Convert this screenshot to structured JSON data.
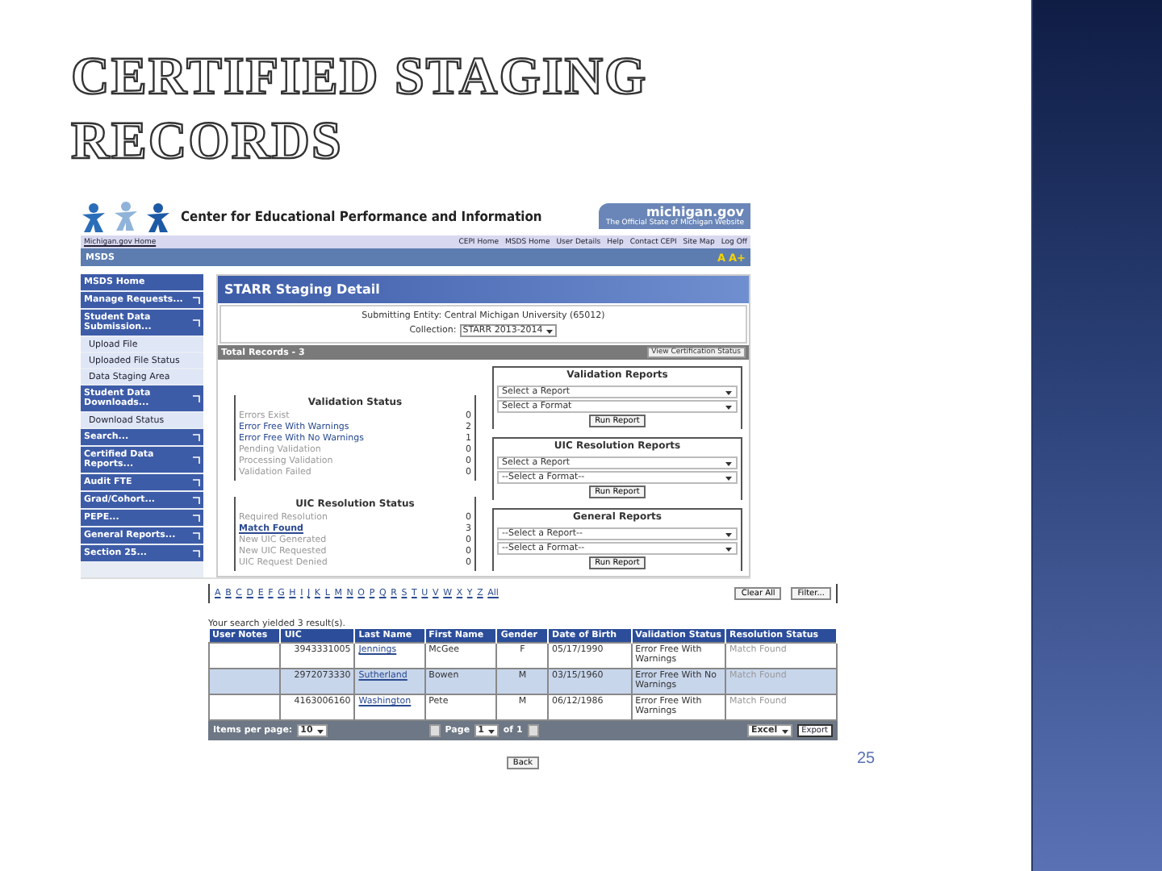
{
  "slide": {
    "title": "CERTIFIED STAGING RECORDS",
    "page_number": "25"
  },
  "header": {
    "agency": "Center for Educational Performance and Information",
    "state_logo": "michigan.gov",
    "state_tagline": "The Official State of Michigan Website"
  },
  "top_links": {
    "home": "Michigan.gov Home",
    "links": [
      "CEPI Home",
      "MSDS Home",
      "User Details",
      "Help",
      "Contact CEPI",
      "Site Map",
      "Log Off"
    ]
  },
  "app_bar": {
    "title": "MSDS",
    "font_buttons": [
      "A",
      "A+"
    ]
  },
  "sidebar": {
    "items": [
      {
        "label": "MSDS Home",
        "has_menu": false
      },
      {
        "label": "Manage Requests...",
        "has_menu": true
      },
      {
        "label": "Student Data Submission...",
        "has_menu": true,
        "children": [
          "Upload File",
          "Uploaded File Status",
          "Data Staging Area"
        ]
      },
      {
        "label": "Student Data Downloads...",
        "has_menu": true,
        "children": [
          "Download Status"
        ]
      },
      {
        "label": "Search...",
        "has_menu": true
      },
      {
        "label": "Certified Data Reports...",
        "has_menu": true
      },
      {
        "label": "Audit FTE",
        "has_menu": true
      },
      {
        "label": "Grad/Cohort...",
        "has_menu": true
      },
      {
        "label": "PEPE...",
        "has_menu": true
      },
      {
        "label": "General Reports...",
        "has_menu": true
      },
      {
        "label": "Section 25...",
        "has_menu": true
      }
    ]
  },
  "main": {
    "title": "STARR Staging Detail",
    "entity": "Submitting Entity: Central Michigan University (65012)",
    "collection_label": "Collection:",
    "collection": "STARR 2013-2014",
    "total": "Total Records - 3",
    "status_button": "View Certification Status",
    "status_panels": [
      {
        "title": "Validation Status",
        "rows": [
          {
            "label": "Errors Exist",
            "count": "0",
            "enabled": false,
            "selected": false
          },
          {
            "label": "Error Free With Warnings",
            "count": "2",
            "enabled": true,
            "selected": false
          },
          {
            "label": "Error Free With No Warnings",
            "count": "1",
            "enabled": true,
            "selected": false
          },
          {
            "label": "Pending Validation",
            "count": "0",
            "enabled": false,
            "selected": false
          },
          {
            "label": "Processing Validation",
            "count": "0",
            "enabled": false,
            "selected": false
          },
          {
            "label": "Validation Failed",
            "count": "0",
            "enabled": false,
            "selected": false
          }
        ]
      },
      {
        "title": "UIC Resolution Status",
        "rows": [
          {
            "label": "Required Resolution",
            "count": "0",
            "enabled": false,
            "selected": false
          },
          {
            "label": "Match Found",
            "count": "3",
            "enabled": true,
            "selected": true
          },
          {
            "label": "New UIC Generated",
            "count": "0",
            "enabled": false,
            "selected": false
          },
          {
            "label": "New UIC Requested",
            "count": "0",
            "enabled": false,
            "selected": false
          },
          {
            "label": "UIC Request Denied",
            "count": "0",
            "enabled": false,
            "selected": false
          }
        ]
      }
    ],
    "report_panels": [
      {
        "title": "Validation Reports",
        "selects": [
          "Select a Report",
          "Select a Format"
        ],
        "button": "Run Report"
      },
      {
        "title": "UIC Resolution Reports",
        "selects": [
          "Select a Report",
          "--Select a Format--"
        ],
        "button": "Run Report"
      },
      {
        "title": "General Reports",
        "selects": [
          "--Select a Report--",
          "--Select a Format--"
        ],
        "button": "Run Report"
      }
    ]
  },
  "filter": {
    "letters": [
      "A",
      "B",
      "C",
      "D",
      "E",
      "F",
      "G",
      "H",
      "I",
      "J",
      "K",
      "L",
      "M",
      "N",
      "O",
      "P",
      "Q",
      "R",
      "S",
      "T",
      "U",
      "V",
      "W",
      "X",
      "Y",
      "Z",
      "All"
    ],
    "clear_button": "Clear All",
    "filter_button": "Filter..."
  },
  "results": {
    "summary": "Your search yielded 3 result(s).",
    "columns": [
      "User Notes",
      "UIC",
      "Last Name",
      "First Name",
      "Gender",
      "Date of Birth",
      "Validation Status",
      "Resolution Status"
    ],
    "rows": [
      {
        "uic": "3943331005",
        "last_name": "Jennings",
        "first_name": "McGee",
        "gender": "F",
        "dob": "05/17/1990",
        "validation": "Error Free With Warnings",
        "resolution": "Match Found",
        "selected": false
      },
      {
        "uic": "2972073330",
        "last_name": "Sutherland",
        "first_name": "Bowen",
        "gender": "M",
        "dob": "03/15/1960",
        "validation": "Error Free With No Warnings",
        "resolution": "Match Found",
        "selected": true
      },
      {
        "uic": "4163006160",
        "last_name": "Washington",
        "first_name": "Pete",
        "gender": "M",
        "dob": "06/12/1986",
        "validation": "Error Free With Warnings",
        "resolution": "Match Found",
        "selected": false
      }
    ],
    "pager": {
      "items_label": "Items per page:",
      "items_value": "10",
      "page_label": "Page",
      "page_value": "1",
      "page_of": "of 1",
      "format": "Excel",
      "export_button": "Export"
    },
    "back_button": "Back"
  }
}
